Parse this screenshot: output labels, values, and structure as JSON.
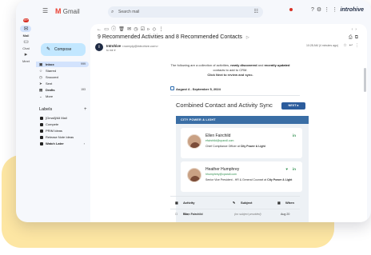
{
  "app": {
    "name": "Gmail",
    "brand": "introhive"
  },
  "rail": {
    "items": [
      {
        "label": "Mail",
        "icon": "mail-icon",
        "badge": "99+"
      },
      {
        "label": "Chat",
        "icon": "chat-icon"
      },
      {
        "label": "Meet",
        "icon": "video-icon"
      }
    ]
  },
  "search": {
    "placeholder": "Search mail"
  },
  "status": {
    "label": "Active"
  },
  "compose": {
    "label": "Compose"
  },
  "nav": {
    "items": [
      {
        "label": "Inbox",
        "icon": "inbox-icon",
        "count": "999",
        "active": true
      },
      {
        "label": "Starred",
        "icon": "star-icon",
        "count": ""
      },
      {
        "label": "Snoozed",
        "icon": "clock-icon",
        "count": ""
      },
      {
        "label": "Sent",
        "icon": "send-icon",
        "count": ""
      },
      {
        "label": "Drafts",
        "icon": "draft-icon",
        "count": "153"
      },
      {
        "label": "More",
        "icon": "chevron-down-icon",
        "count": ""
      }
    ]
  },
  "labels": {
    "heading": "Labels",
    "items": [
      {
        "label": "[Gmail]/All Mail"
      },
      {
        "label": "Compete"
      },
      {
        "label": "PRIM Ideas"
      },
      {
        "label": "Release Note Ideas"
      },
      {
        "label": "Watch Later"
      }
    ]
  },
  "email": {
    "subject": "9 Recommended Activities and 8 Recommended Contacts",
    "sender_name": "Introhive",
    "sender_address": "<noreply@introhive.com>",
    "to": "to me",
    "date": "10:28 AM (4 minutes ago)",
    "intro_pre": "The following are a collection of activities, ",
    "intro_bold1": "newly discovered",
    "intro_mid": " and ",
    "intro_bold2": "recently updated",
    "intro_post": " contacts to add to CRM.",
    "intro_cta": "Click Next to review and sync.",
    "date_range": "August 4 - September 5, 2024",
    "sync_title": "Combined Contact and Activity Sync",
    "next_button": "NEXT ▸"
  },
  "card": {
    "header": "CITY POWER & LIGHT",
    "contacts": [
      {
        "name": "Ellen Fairchild",
        "email": "efairchild@cpandl.com",
        "title": "Chief Compliance Officer at ",
        "company": "City Power & Light"
      },
      {
        "name": "Heather Humphrey",
        "email": "hhumphrey@cpandl.com",
        "title": "Senior Vice President - HR & General Counsel at ",
        "company": "City Power & Light"
      }
    ]
  },
  "activity": {
    "headers": [
      "Activity",
      "Subject",
      "When"
    ],
    "rows": [
      {
        "activity_prefix": "You, ",
        "person": "Ellen Fairchild",
        "subject": "(no subject provided)",
        "when": "Aug 20"
      }
    ]
  }
}
